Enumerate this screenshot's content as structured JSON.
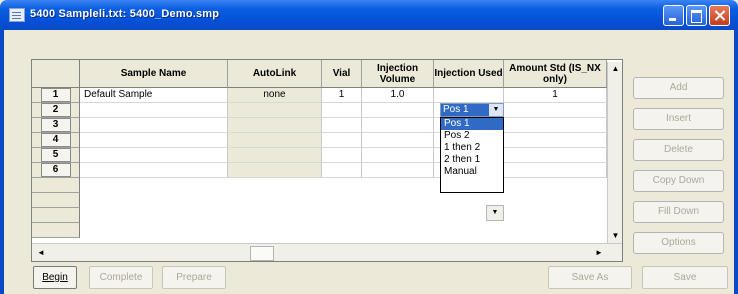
{
  "window": {
    "title": "5400 Sampleli.txt: 5400_Demo.smp"
  },
  "grid": {
    "columns": [
      "",
      "Sample Name",
      "AutoLink",
      "Vial",
      "Injection Volume",
      "Injection Used",
      "Amount Std (IS_NX only)"
    ],
    "rows": [
      {
        "num": "1",
        "name": "Default Sample",
        "autolink": "none",
        "vial": "1",
        "inj_vol": "1.0",
        "inj_used": "Pos 1",
        "amount": "1"
      },
      {
        "num": "2",
        "name": "",
        "autolink": "",
        "vial": "",
        "inj_vol": "",
        "inj_used": "",
        "amount": ""
      },
      {
        "num": "3",
        "name": "",
        "autolink": "",
        "vial": "",
        "inj_vol": "",
        "inj_used": "",
        "amount": ""
      },
      {
        "num": "4",
        "name": "",
        "autolink": "",
        "vial": "",
        "inj_vol": "",
        "inj_used": "",
        "amount": ""
      },
      {
        "num": "5",
        "name": "",
        "autolink": "",
        "vial": "",
        "inj_vol": "",
        "inj_used": "",
        "amount": ""
      },
      {
        "num": "6",
        "name": "",
        "autolink": "",
        "vial": "",
        "inj_vol": "",
        "inj_used": "",
        "amount": ""
      }
    ]
  },
  "dropdown": {
    "selected": "Pos 1",
    "options": [
      "Pos 1",
      "Pos 2",
      "1 then 2",
      "2 then 1",
      "Manual"
    ],
    "highlighted": "Pos 1"
  },
  "side_buttons": [
    "Add",
    "Insert",
    "Delete",
    "Copy Down",
    "Fill Down",
    "Options"
  ],
  "bottom_buttons": {
    "begin": "Begin",
    "complete": "Complete",
    "prepare": "Prepare",
    "save_as": "Save As",
    "save": "Save"
  },
  "icons": {
    "app": "spreadsheet-icon",
    "scroll_up": "arrow-up-icon",
    "scroll_down": "arrow-down-icon",
    "scroll_left": "arrow-left-icon",
    "scroll_right": "arrow-right-icon"
  },
  "colors": {
    "titlebar": "#0a5ee0",
    "selection": "#316ac5",
    "face": "#ece9d8"
  }
}
